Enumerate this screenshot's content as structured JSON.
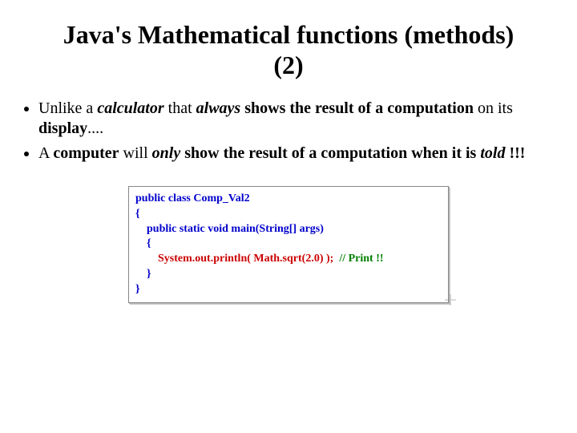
{
  "title": "Java's Mathematical functions (methods) (2)",
  "bullet1": {
    "t1": "Unlike a ",
    "t2": "calculator",
    "t3": " that ",
    "t4": "always",
    "t5": " shows the result of a computation",
    "t6": " on its ",
    "t7": "display",
    "t8": "...."
  },
  "bullet2": {
    "t1": "A ",
    "t2": "computer",
    "t3": " will ",
    "t4": "only",
    "t5": " show the result of a computation when it is ",
    "t6": "told",
    "t7": " !!!"
  },
  "code": {
    "l1": "public class Comp_Val2",
    "l2": "{",
    "l3": "public static void main(String[] args)",
    "l4": "{",
    "l5a": "System.out.println( Math.sqrt(2.0) );",
    "l5b": "  // Print !!",
    "l6": "}",
    "l7": "}"
  }
}
